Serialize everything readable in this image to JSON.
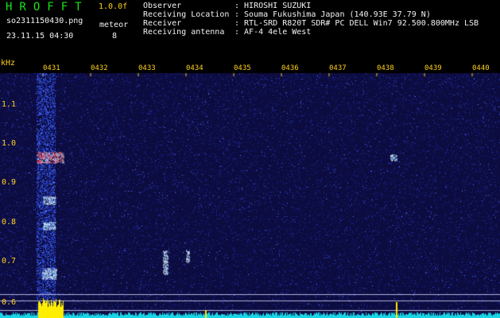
{
  "header": {
    "app_title": "HROFFT",
    "version": "1.0.0f",
    "filename": "so2311150430.png",
    "datetime": "23.11.15 04:30",
    "meteor_label": "meteor",
    "meteor_count": "8"
  },
  "info": [
    {
      "key": "Observer",
      "value": ": HIROSHI SUZUKI"
    },
    {
      "key": "Receiving Location",
      "value": ": Souma Fukushima Japan (140.93E 37.79 N)"
    },
    {
      "key": "Receiver",
      "value": ": RTL-SRD R820T SDR# PC DELL Win7 92.500.800MHz LSB"
    },
    {
      "key": "Receiving antenna",
      "value": ": AF-4 4ele West"
    }
  ],
  "chart_data": {
    "type": "heatmap",
    "y_unit": "kHz",
    "y_ticks": [
      "1.1",
      "1.0",
      "0.9",
      "0.8",
      "0.7",
      "0.6"
    ],
    "x_ticks": [
      "0431",
      "0432",
      "0433",
      "0434",
      "0435",
      "0436",
      "0437",
      "0438",
      "0439",
      "0440"
    ],
    "colors": {
      "background": "#0c0c40",
      "noise": "#2a3cc8",
      "signal": "#ff3030",
      "label": "#ffd11a",
      "baseline": "#19d6e6",
      "band": "#ffee00"
    }
  }
}
